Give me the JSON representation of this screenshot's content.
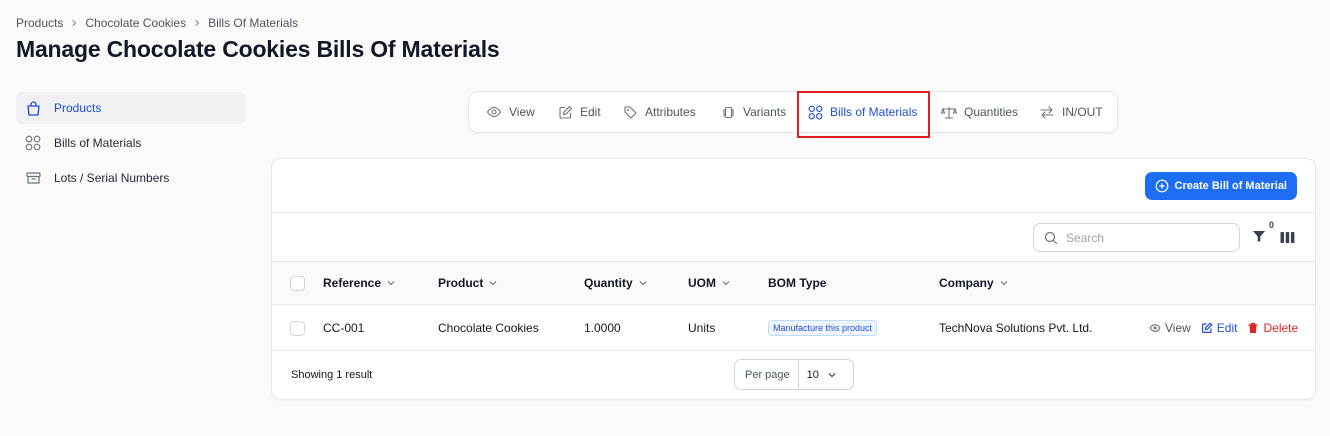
{
  "breadcrumb": [
    "Products",
    "Chocolate Cookies",
    "Bills Of Materials"
  ],
  "page_title": "Manage Chocolate Cookies Bills Of Materials",
  "sidebar": {
    "items": [
      {
        "label": "Products",
        "icon": "shopping-bag-icon",
        "active": true
      },
      {
        "label": "Bills of Materials",
        "icon": "grid-circles-icon",
        "active": false
      },
      {
        "label": "Lots / Serial Numbers",
        "icon": "archive-box-icon",
        "active": false
      }
    ]
  },
  "tabs": [
    {
      "label": "View",
      "icon": "eye-icon"
    },
    {
      "label": "Edit",
      "icon": "pencil-square-icon"
    },
    {
      "label": "Attributes",
      "icon": "tags-icon"
    },
    {
      "label": "Variants",
      "icon": "cards-icon"
    },
    {
      "label": "Bills of Materials",
      "icon": "grid-circles-icon",
      "active": true
    },
    {
      "label": "Quantities",
      "icon": "scale-icon"
    },
    {
      "label": "IN/OUT",
      "icon": "arrows-exchange-icon"
    }
  ],
  "panel": {
    "create_label": "Create Bill of Material",
    "search_placeholder": "Search",
    "filter_count": "0"
  },
  "table": {
    "columns": [
      "Reference",
      "Product",
      "Quantity",
      "UOM",
      "BOM Type",
      "Company"
    ],
    "rows": [
      {
        "reference": "CC-001",
        "product": "Chocolate Cookies",
        "quantity": "1.0000",
        "uom": "Units",
        "bom_type": "Manufacture this product",
        "company": "TechNova Solutions Pvt. Ltd.",
        "actions": {
          "view": "View",
          "edit": "Edit",
          "delete": "Delete"
        }
      }
    ]
  },
  "footer": {
    "showing": "Showing 1 result",
    "per_page_label": "Per page",
    "per_page_value": "10"
  },
  "colors": {
    "accent": "#1d6ef5",
    "active_text": "#1d4ed8",
    "delete": "#dc2626",
    "highlight": "#e11d1d"
  }
}
